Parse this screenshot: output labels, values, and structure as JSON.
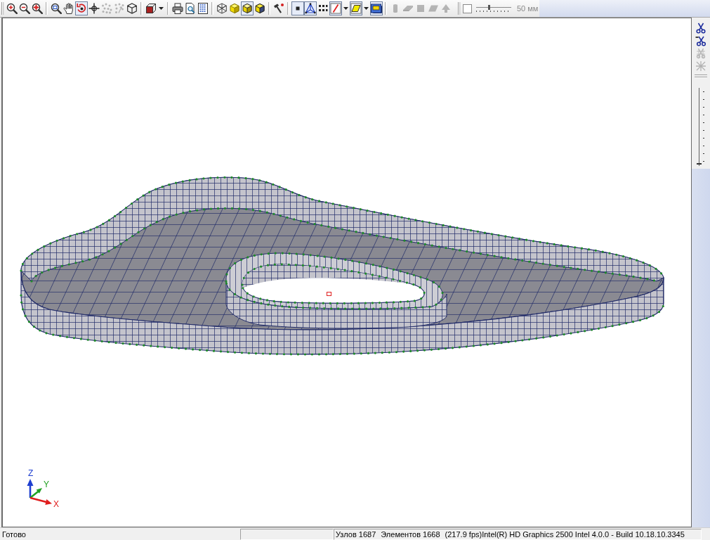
{
  "toolbar": {
    "groups": [
      {
        "buttons": [
          {
            "kind": "button",
            "selected": false,
            "disabled": false
          },
          {
            "kind": "button",
            "selected": false,
            "disabled": false
          },
          {
            "kind": "button",
            "selected": false,
            "disabled": false
          }
        ]
      },
      {
        "buttons": [
          {
            "kind": "button",
            "selected": false,
            "disabled": false
          },
          {
            "kind": "button",
            "selected": false,
            "disabled": false
          },
          {
            "kind": "button",
            "selected": true,
            "disabled": false
          },
          {
            "kind": "button",
            "selected": false,
            "disabled": false
          },
          {
            "kind": "button",
            "selected": false,
            "disabled": true
          },
          {
            "kind": "button",
            "selected": false,
            "disabled": true
          },
          {
            "kind": "button",
            "selected": false,
            "disabled": false
          }
        ]
      },
      {
        "buttons": [
          {
            "kind": "dropdown",
            "selected": false,
            "disabled": false
          }
        ]
      },
      {
        "buttons": [
          {
            "kind": "button",
            "selected": false,
            "disabled": false
          },
          {
            "kind": "button",
            "selected": false,
            "disabled": false
          },
          {
            "kind": "button",
            "selected": false,
            "disabled": false
          }
        ]
      },
      {
        "buttons": [
          {
            "kind": "button",
            "selected": false,
            "disabled": false
          },
          {
            "kind": "button",
            "selected": false,
            "disabled": false
          },
          {
            "kind": "button",
            "selected": true,
            "disabled": false
          },
          {
            "kind": "button",
            "selected": false,
            "disabled": false
          }
        ]
      },
      {
        "buttons": [
          {
            "kind": "button",
            "selected": false,
            "disabled": false
          }
        ]
      },
      {
        "buttons": [
          {
            "kind": "button",
            "selected": true,
            "disabled": false
          },
          {
            "kind": "button",
            "selected": true,
            "disabled": false
          },
          {
            "kind": "button",
            "selected": false,
            "disabled": false
          },
          {
            "kind": "dropdown",
            "selected": true,
            "disabled": false
          },
          {
            "kind": "dropdown",
            "selected": true,
            "disabled": false
          },
          {
            "kind": "button",
            "selected": true,
            "disabled": false
          }
        ]
      },
      {
        "buttons": [
          {
            "kind": "button",
            "selected": false,
            "disabled": true
          },
          {
            "kind": "button",
            "selected": false,
            "disabled": true
          },
          {
            "kind": "button",
            "selected": false,
            "disabled": true
          },
          {
            "kind": "button",
            "selected": false,
            "disabled": true
          },
          {
            "kind": "button",
            "selected": false,
            "disabled": true
          }
        ]
      }
    ],
    "scale": {
      "checked": false,
      "level": 0.35,
      "label": "50 мм"
    }
  },
  "viewport": {
    "axes": [
      {
        "label": "Z",
        "color": "#1f3fd0"
      },
      {
        "label": "Y",
        "color": "#22a022"
      },
      {
        "label": "X",
        "color": "#e01e1e"
      }
    ]
  },
  "side_panel": {
    "tools": [
      {
        "disabled": false
      },
      {
        "disabled": false
      },
      {
        "disabled": true
      },
      {
        "disabled": true
      }
    ],
    "slider": {
      "level": 0
    }
  },
  "status_bar": {
    "message": "Готово",
    "nodes": "Узлов 1687",
    "elements": "Элементов 1668",
    "renderer": "(217.9 fps)Intel(R) HD Graphics 2500 Intel 4.0.0 - Build 10.18.10.3345"
  }
}
